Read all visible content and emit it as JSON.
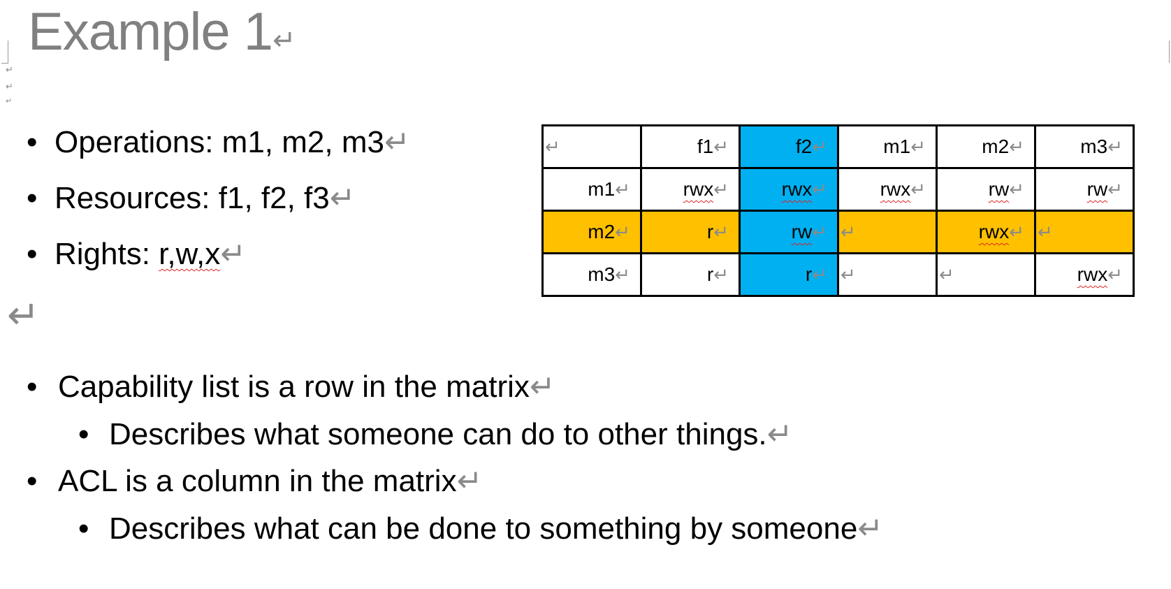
{
  "title": "Example 1",
  "para_mark": "↵",
  "bullets_top": [
    {
      "text": "Operations: m1, m2, m3"
    },
    {
      "text": "Resources: f1, f2, f3"
    },
    {
      "label": "Rights: ",
      "value": "r,w,x"
    }
  ],
  "matrix": {
    "header": [
      "",
      "f1",
      "f2",
      "m1",
      "m2",
      "m3"
    ],
    "rows": [
      [
        "m1",
        "rwx",
        "rwx",
        "rwx",
        "rw",
        "rw"
      ],
      [
        "m2",
        "r",
        "rw",
        "",
        "rwx",
        ""
      ],
      [
        "m3",
        "r",
        "r",
        "",
        "",
        "rwx"
      ]
    ],
    "highlight_row_color": "#ffc000",
    "highlight_col_color": "#00b0f0"
  },
  "bullets_bottom": [
    {
      "text": "Capability list is a row in the matrix",
      "level": 1
    },
    {
      "text": "Describes what someone can do to other things.",
      "level": 2
    },
    {
      "text": "ACL is a column in the matrix",
      "level": 1
    },
    {
      "text": "Describes what can be done to something by someone",
      "level": 2
    }
  ]
}
